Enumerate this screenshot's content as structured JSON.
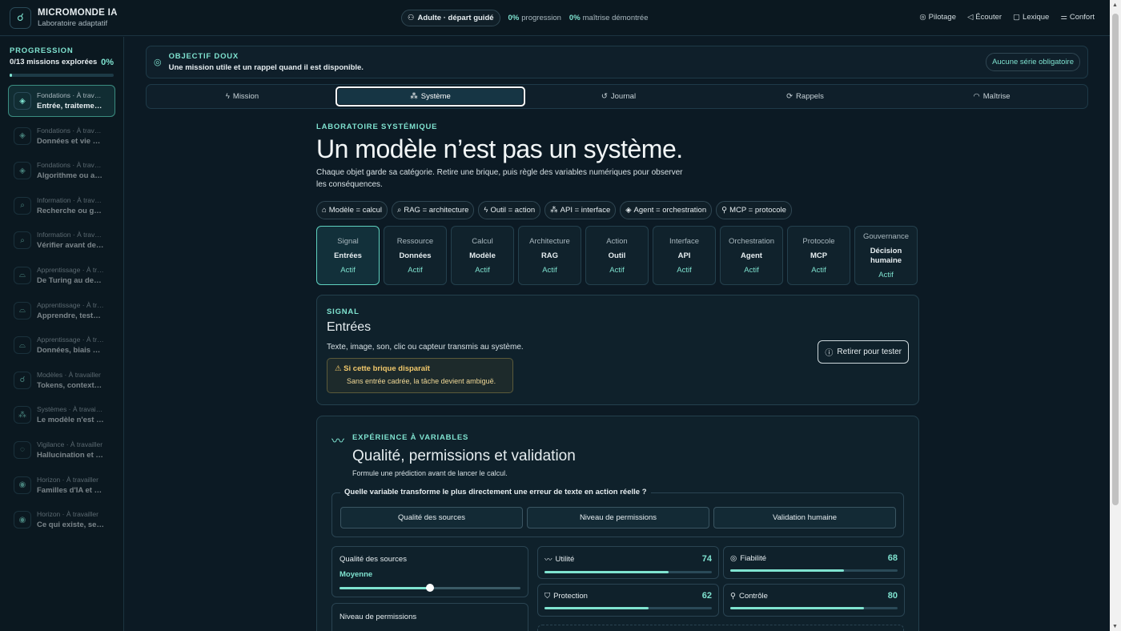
{
  "topbar": {
    "title": "MICROMONDE IA",
    "subtitle": "Laboratoire adaptatif",
    "mode": "Adulte · départ guidé",
    "progress_value": "0%",
    "progress_label": "progression",
    "mastery_value": "0%",
    "mastery_label": "maîtrise démontrée",
    "actions": [
      "Pilotage",
      "Écouter",
      "Lexique",
      "Confort"
    ]
  },
  "sidebar": {
    "title": "PROGRESSION",
    "count": "0/13 missions explorées",
    "percent": "0%",
    "progress_fraction": 0.02,
    "items": [
      {
        "cat": "Fondations · À travailler",
        "label": "Entrée, traitement, sortie"
      },
      {
        "cat": "Fondations · À travailler",
        "label": "Données et vie privée"
      },
      {
        "cat": "Fondations · À travailler",
        "label": "Algorithme ou apprentissage"
      },
      {
        "cat": "Information · À travailler",
        "label": "Recherche ou génération"
      },
      {
        "cat": "Information · À travailler",
        "label": "Vérifier avant de partager"
      },
      {
        "cat": "Apprentissage · À travailler",
        "label": "De Turing au deep learning"
      },
      {
        "cat": "Apprentissage · À travailler",
        "label": "Apprendre, tester, corriger"
      },
      {
        "cat": "Apprentissage · À travailler",
        "label": "Données, biais et contexte"
      },
      {
        "cat": "Modèles · À travailler",
        "label": "Tokens, contexte et mémoire"
      },
      {
        "cat": "Systèmes · À travailler",
        "label": "Le modèle n'est qu'une partie"
      },
      {
        "cat": "Vigilance · À travailler",
        "label": "Hallucination et vérification"
      },
      {
        "cat": "Horizon · À travailler",
        "label": "Familles d'IA et usages"
      },
      {
        "cat": "Horizon · À travailler",
        "label": "Ce qui existe, se teste, arrive"
      }
    ]
  },
  "objectif": {
    "title": "OBJECTIF DOUX",
    "text": "Une mission utile et un rappel quand il est disponible.",
    "badge": "Aucune série obligatoire"
  },
  "tabs": [
    "Mission",
    "Système",
    "Journal",
    "Rappels",
    "Maîtrise"
  ],
  "lab": {
    "eyebrow": "LABORATOIRE SYSTÉMIQUE",
    "title": "Un modèle n’est pas un système.",
    "lead": "Chaque objet garde sa catégorie. Retire une brique, puis règle des variables numériques pour observer les conséquences.",
    "chips": [
      "Modèle = calcul",
      "RAG = architecture",
      "Outil = action",
      "API = interface",
      "Agent = orchestration",
      "MCP = protocole"
    ],
    "cards": [
      {
        "cat": "Signal",
        "name": "Entrées",
        "state": "Actif"
      },
      {
        "cat": "Ressource",
        "name": "Données",
        "state": "Actif"
      },
      {
        "cat": "Calcul",
        "name": "Modèle",
        "state": "Actif"
      },
      {
        "cat": "Architecture",
        "name": "RAG",
        "state": "Actif"
      },
      {
        "cat": "Action",
        "name": "Outil",
        "state": "Actif"
      },
      {
        "cat": "Interface",
        "name": "API",
        "state": "Actif"
      },
      {
        "cat": "Orchestration",
        "name": "Agent",
        "state": "Actif"
      },
      {
        "cat": "Protocole",
        "name": "MCP",
        "state": "Actif"
      },
      {
        "cat": "Gouvernance",
        "name": "Décision humaine",
        "state": "Actif"
      }
    ]
  },
  "signal": {
    "eyebrow": "SIGNAL",
    "title": "Entrées",
    "desc": "Texte, image, son, clic ou capteur transmis au système.",
    "warn_title": "Si cette brique disparaît",
    "warn_desc": "Sans entrée cadrée, la tâche devient ambiguë.",
    "button": "Retirer pour tester"
  },
  "experience": {
    "eyebrow": "EXPÉRIENCE À VARIABLES",
    "title": "Qualité, permissions et validation",
    "sub": "Formule une prédiction avant de lancer le calcul.",
    "question": "Quelle variable transforme le plus directement une erreur de texte en action réelle ?",
    "options": [
      "Qualité des sources",
      "Niveau de permissions",
      "Validation humaine"
    ],
    "slider1": {
      "label": "Qualité des sources",
      "value": "Moyenne",
      "fraction": 0.5
    },
    "slider2": {
      "label": "Niveau de permissions"
    },
    "metrics": [
      {
        "label": "Utilité",
        "value": 74
      },
      {
        "label": "Fiabilité",
        "value": 68
      },
      {
        "label": "Protection",
        "value": 62
      },
      {
        "label": "Contrôle",
        "value": 80
      }
    ]
  }
}
